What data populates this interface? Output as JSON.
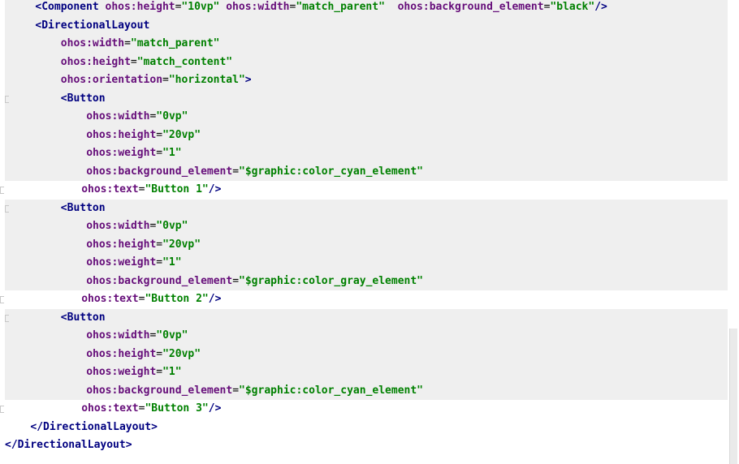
{
  "lines": [
    {
      "indent": "    ",
      "parts": [
        [
          "tag",
          "<Component"
        ],
        [
          "punct",
          " "
        ],
        [
          "attr",
          "ohos:height"
        ],
        [
          "punct",
          "="
        ],
        [
          "val",
          "\"10vp\""
        ],
        [
          "punct",
          " "
        ],
        [
          "attr",
          "ohos:width"
        ],
        [
          "punct",
          "="
        ],
        [
          "val",
          "\"match_parent\""
        ],
        [
          "punct",
          "  "
        ],
        [
          "attr",
          "ohos:background_element"
        ],
        [
          "punct",
          "="
        ],
        [
          "val",
          "\"black\""
        ],
        [
          "tag",
          "/>"
        ]
      ]
    },
    {
      "indent": "    ",
      "parts": [
        [
          "tag",
          "<DirectionalLayout"
        ]
      ]
    },
    {
      "indent": "        ",
      "parts": [
        [
          "attr",
          "ohos:width"
        ],
        [
          "punct",
          "="
        ],
        [
          "val",
          "\"match_parent\""
        ]
      ]
    },
    {
      "indent": "        ",
      "parts": [
        [
          "attr",
          "ohos:height"
        ],
        [
          "punct",
          "="
        ],
        [
          "val",
          "\"match_content\""
        ]
      ]
    },
    {
      "indent": "        ",
      "parts": [
        [
          "attr",
          "ohos:orientation"
        ],
        [
          "punct",
          "="
        ],
        [
          "val",
          "\"horizontal\""
        ],
        [
          "tag",
          ">"
        ]
      ]
    },
    {
      "indent": "        ",
      "parts": [
        [
          "tag",
          "<Button"
        ]
      ]
    },
    {
      "indent": "            ",
      "parts": [
        [
          "attr",
          "ohos:width"
        ],
        [
          "punct",
          "="
        ],
        [
          "val",
          "\"0vp\""
        ]
      ]
    },
    {
      "indent": "            ",
      "parts": [
        [
          "attr",
          "ohos:height"
        ],
        [
          "punct",
          "="
        ],
        [
          "val",
          "\"20vp\""
        ]
      ]
    },
    {
      "indent": "            ",
      "parts": [
        [
          "attr",
          "ohos:weight"
        ],
        [
          "punct",
          "="
        ],
        [
          "val",
          "\"1\""
        ]
      ]
    },
    {
      "indent": "            ",
      "parts": [
        [
          "attr",
          "ohos:background_element"
        ],
        [
          "punct",
          "="
        ],
        [
          "val",
          "\"$graphic:color_cyan_element\""
        ]
      ]
    },
    {
      "indent": "            ",
      "parts": [
        [
          "attr",
          "ohos:text"
        ],
        [
          "punct",
          "="
        ],
        [
          "val",
          "\"Button 1\""
        ],
        [
          "tag",
          "/>"
        ]
      ]
    },
    {
      "indent": "        ",
      "parts": [
        [
          "tag",
          "<Button"
        ]
      ]
    },
    {
      "indent": "            ",
      "parts": [
        [
          "attr",
          "ohos:width"
        ],
        [
          "punct",
          "="
        ],
        [
          "val",
          "\"0vp\""
        ]
      ]
    },
    {
      "indent": "            ",
      "parts": [
        [
          "attr",
          "ohos:height"
        ],
        [
          "punct",
          "="
        ],
        [
          "val",
          "\"20vp\""
        ]
      ]
    },
    {
      "indent": "            ",
      "parts": [
        [
          "attr",
          "ohos:weight"
        ],
        [
          "punct",
          "="
        ],
        [
          "val",
          "\"1\""
        ]
      ]
    },
    {
      "indent": "            ",
      "parts": [
        [
          "attr",
          "ohos:background_element"
        ],
        [
          "punct",
          "="
        ],
        [
          "val",
          "\"$graphic:color_gray_element\""
        ]
      ]
    },
    {
      "indent": "            ",
      "parts": [
        [
          "attr",
          "ohos:text"
        ],
        [
          "punct",
          "="
        ],
        [
          "val",
          "\"Button 2\""
        ],
        [
          "tag",
          "/>"
        ]
      ]
    },
    {
      "indent": "        ",
      "parts": [
        [
          "tag",
          "<Button"
        ]
      ]
    },
    {
      "indent": "            ",
      "parts": [
        [
          "attr",
          "ohos:width"
        ],
        [
          "punct",
          "="
        ],
        [
          "val",
          "\"0vp\""
        ]
      ]
    },
    {
      "indent": "            ",
      "parts": [
        [
          "attr",
          "ohos:height"
        ],
        [
          "punct",
          "="
        ],
        [
          "val",
          "\"20vp\""
        ]
      ]
    },
    {
      "indent": "            ",
      "parts": [
        [
          "attr",
          "ohos:weight"
        ],
        [
          "punct",
          "="
        ],
        [
          "val",
          "\"1\""
        ]
      ]
    },
    {
      "indent": "            ",
      "parts": [
        [
          "attr",
          "ohos:background_element"
        ],
        [
          "punct",
          "="
        ],
        [
          "val",
          "\"$graphic:color_cyan_element\""
        ]
      ]
    },
    {
      "indent": "            ",
      "parts": [
        [
          "attr",
          "ohos:text"
        ],
        [
          "punct",
          "="
        ],
        [
          "val",
          "\"Button 3\""
        ],
        [
          "tag",
          "/>"
        ]
      ]
    },
    {
      "indent": "    ",
      "parts": [
        [
          "tag",
          "</DirectionalLayout>"
        ]
      ]
    },
    {
      "indent": "",
      "parts": [
        [
          "tag",
          "</DirectionalLayout>"
        ]
      ]
    }
  ],
  "highlight": [
    true,
    true,
    true,
    true,
    true,
    true,
    true,
    true,
    true,
    true,
    false,
    true,
    true,
    true,
    true,
    true,
    false,
    true,
    true,
    true,
    true,
    true,
    false,
    false,
    false
  ],
  "gutter_marks": [
    false,
    false,
    false,
    false,
    false,
    true,
    false,
    false,
    false,
    false,
    true,
    true,
    false,
    false,
    false,
    false,
    true,
    true,
    false,
    false,
    false,
    false,
    true,
    false,
    false
  ],
  "colors": {
    "tag": "#000080",
    "attribute": "#660e7a",
    "value": "#008000",
    "highlight_bg": "#efefef"
  }
}
